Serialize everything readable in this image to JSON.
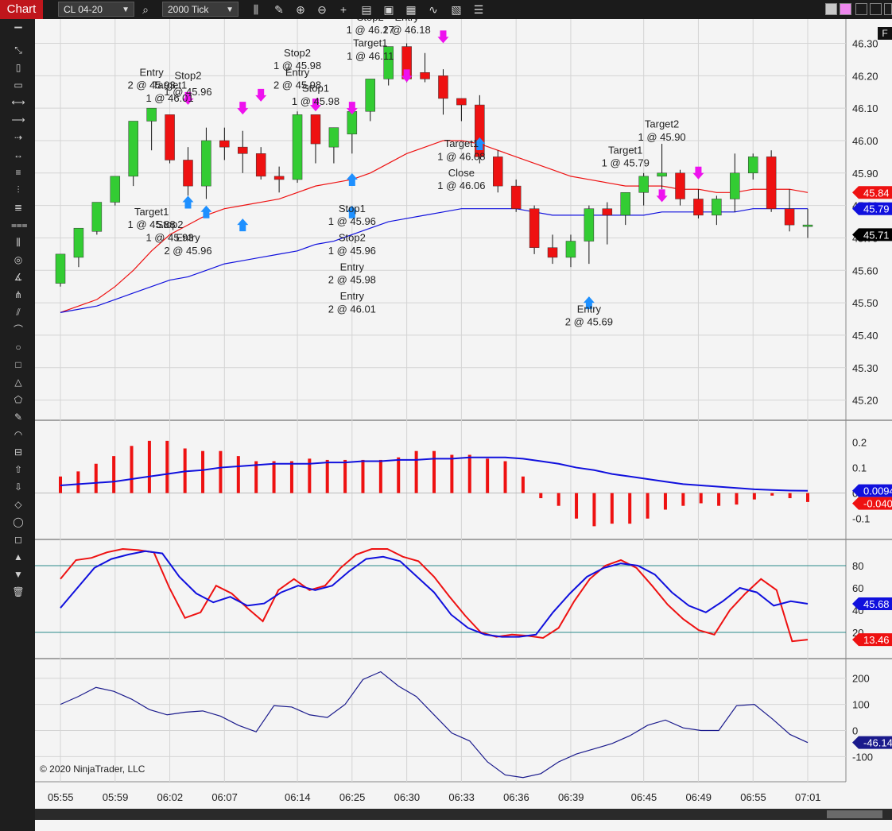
{
  "toolbar": {
    "tab_label": "Chart",
    "instrument": "CL 04-20",
    "interval": "2000 Tick",
    "icons": [
      "search-icon",
      "bar-type-icon",
      "pencil-icon",
      "zoom-in-icon",
      "zoom-out-icon",
      "crosshair-icon",
      "data-box-icon",
      "properties-icon",
      "strategies-icon",
      "indicators-icon",
      "templates-icon",
      "list-icon"
    ]
  },
  "side_toolbar_icons": [
    "ruler-icon",
    "risk-reward-icon",
    "region-icon",
    "range-icon",
    "line-icon",
    "ray-icon",
    "arrow-line-icon",
    "extended-line-icon",
    "horizontal-line-icon",
    "vertical-line-icon",
    "fib-retracement-icon",
    "fib-extension-icon",
    "fib-time-icon",
    "fib-circle-icon",
    "gann-fan-icon",
    "andrews-pitchfork-icon",
    "regression-channel-icon",
    "arc-icon",
    "ellipse-icon",
    "rectangle-icon",
    "triangle-icon",
    "polygon-icon",
    "text-icon",
    "arc2-icon",
    "ruler2-icon",
    "arrow-up-icon",
    "arrow-down-icon",
    "diamond-icon",
    "dot-icon",
    "square-icon",
    "triangle-up-icon",
    "triangle-down-icon",
    "trash-icon"
  ],
  "copyright": "© 2020 NinjaTrader, LLC",
  "corner_label": "F",
  "colors": {
    "up": "#33cc33",
    "down": "#ee1111",
    "blue": "#1010dd",
    "red": "#ee1111",
    "teal": "#2a8a8a",
    "navy": "#1a1a8c",
    "magenta": "#ee11ee",
    "entry_blue": "#1e90ff"
  },
  "chart_data": [
    {
      "type": "candlestick",
      "panel": "price",
      "x_labels": [
        "05:55",
        "05:59",
        "06:02",
        "06:07",
        "06:14",
        "06:25",
        "06:30",
        "06:33",
        "06:36",
        "06:39",
        "06:45",
        "06:49",
        "06:55",
        "07:01"
      ],
      "y_ticks": [
        46.3,
        46.2,
        46.1,
        46.0,
        45.9,
        45.8,
        45.7,
        45.6,
        45.5,
        45.4,
        45.3,
        45.2
      ],
      "ylim": [
        45.15,
        46.36
      ],
      "candles": [
        [
          45.56,
          45.65,
          45.55,
          45.65
        ],
        [
          45.64,
          45.73,
          45.61,
          45.73
        ],
        [
          45.72,
          45.81,
          45.71,
          45.81
        ],
        [
          45.81,
          45.89,
          45.8,
          45.89
        ],
        [
          45.89,
          46.06,
          45.86,
          46.06
        ],
        [
          46.06,
          46.1,
          45.97,
          46.08
        ],
        [
          46.08,
          45.94,
          45.93,
          46.08
        ],
        [
          45.94,
          45.86,
          45.83,
          45.98
        ],
        [
          45.86,
          46.0,
          45.82,
          46.04
        ],
        [
          46.0,
          45.98,
          45.94,
          46.04
        ],
        [
          45.98,
          45.96,
          45.9,
          46.03
        ],
        [
          45.96,
          45.89,
          45.88,
          45.98
        ],
        [
          45.89,
          45.88,
          45.84,
          45.92
        ],
        [
          45.88,
          46.08,
          45.87,
          46.09
        ],
        [
          46.08,
          45.99,
          45.93,
          46.08
        ],
        [
          45.98,
          46.04,
          45.93,
          46.04
        ],
        [
          46.02,
          46.09,
          45.96,
          46.09
        ],
        [
          46.09,
          46.19,
          46.06,
          46.19
        ],
        [
          46.19,
          46.29,
          46.17,
          46.29
        ],
        [
          46.29,
          46.19,
          46.18,
          46.3
        ],
        [
          46.21,
          46.19,
          46.18,
          46.27
        ],
        [
          46.2,
          46.13,
          46.08,
          46.22
        ],
        [
          46.13,
          46.11,
          46.06,
          46.13
        ],
        [
          46.11,
          45.95,
          45.93,
          46.14
        ],
        [
          45.95,
          45.86,
          45.84,
          45.97
        ],
        [
          45.86,
          45.79,
          45.78,
          45.88
        ],
        [
          45.79,
          45.67,
          45.65,
          45.8
        ],
        [
          45.67,
          45.64,
          45.62,
          45.71
        ],
        [
          45.64,
          45.69,
          45.61,
          45.71
        ],
        [
          45.69,
          45.79,
          45.62,
          45.8
        ],
        [
          45.79,
          45.77,
          45.68,
          45.81
        ],
        [
          45.77,
          45.84,
          45.74,
          45.84
        ],
        [
          45.84,
          45.89,
          45.8,
          45.9
        ],
        [
          45.89,
          45.9,
          45.85,
          45.99
        ],
        [
          45.9,
          45.82,
          45.8,
          45.91
        ],
        [
          45.82,
          45.77,
          45.76,
          45.85
        ],
        [
          45.77,
          45.82,
          45.74,
          45.83
        ],
        [
          45.82,
          45.9,
          45.78,
          45.96
        ],
        [
          45.9,
          45.95,
          45.88,
          45.96
        ],
        [
          45.95,
          45.79,
          45.78,
          45.97
        ],
        [
          45.79,
          45.74,
          45.72,
          45.85
        ],
        [
          45.74,
          45.74,
          45.7,
          45.79
        ]
      ],
      "series": [
        {
          "color": "red",
          "values": [
            45.47,
            45.49,
            45.51,
            45.55,
            45.6,
            45.66,
            45.71,
            45.74,
            45.77,
            45.79,
            45.8,
            45.81,
            45.82,
            45.84,
            45.86,
            45.87,
            45.88,
            45.9,
            45.93,
            45.96,
            45.98,
            46.0,
            46.0,
            45.99,
            45.97,
            45.95,
            45.93,
            45.91,
            45.89,
            45.88,
            45.87,
            45.86,
            45.86,
            45.86,
            45.85,
            45.85,
            45.84,
            45.84,
            45.85,
            45.85,
            45.85,
            45.84
          ]
        },
        {
          "color": "blue",
          "values": [
            45.47,
            45.48,
            45.49,
            45.51,
            45.53,
            45.55,
            45.57,
            45.58,
            45.6,
            45.62,
            45.63,
            45.64,
            45.65,
            45.66,
            45.68,
            45.69,
            45.71,
            45.73,
            45.75,
            45.76,
            45.77,
            45.78,
            45.79,
            45.79,
            45.79,
            45.79,
            45.78,
            45.77,
            45.77,
            45.77,
            45.77,
            45.77,
            45.77,
            45.78,
            45.78,
            45.78,
            45.78,
            45.78,
            45.79,
            45.79,
            45.79,
            45.79
          ]
        }
      ],
      "annotations": [
        {
          "text": "Entry",
          "x": 5,
          "y": 46.2
        },
        {
          "text": "2 @ 45.93",
          "x": 5,
          "y": 46.16
        },
        {
          "text": "Target1",
          "x": 6,
          "y": 46.16
        },
        {
          "text": "1 @ 46.01",
          "x": 6,
          "y": 46.12
        },
        {
          "text": "Stop2",
          "x": 7,
          "y": 46.19
        },
        {
          "text": "1 @ 45.96",
          "x": 7,
          "y": 46.14
        },
        {
          "text": "Target1",
          "x": 5,
          "y": 45.77
        },
        {
          "text": "1 @ 45.88",
          "x": 5,
          "y": 45.73
        },
        {
          "text": "Stop2",
          "x": 6,
          "y": 45.73
        },
        {
          "text": "1 @ 45.93",
          "x": 6,
          "y": 45.69
        },
        {
          "text": "Entry",
          "x": 7,
          "y": 45.69
        },
        {
          "text": "2 @ 45.96",
          "x": 7,
          "y": 45.65
        },
        {
          "text": "Stop2",
          "x": 13,
          "y": 46.26
        },
        {
          "text": "1 @ 45.98",
          "x": 13,
          "y": 46.22
        },
        {
          "text": "Entry",
          "x": 13,
          "y": 46.2
        },
        {
          "text": "2 @ 45.98",
          "x": 13,
          "y": 46.16
        },
        {
          "text": "Stop1",
          "x": 14,
          "y": 46.15
        },
        {
          "text": "1 @ 45.98",
          "x": 14,
          "y": 46.11
        },
        {
          "text": "Target1",
          "x": 17,
          "y": 46.29
        },
        {
          "text": "1 @ 46.11",
          "x": 17,
          "y": 46.25
        },
        {
          "text": "Stop2",
          "x": 17,
          "y": 46.37
        },
        {
          "text": "1 @ 46.17",
          "x": 17,
          "y": 46.33
        },
        {
          "text": "Entry",
          "x": 19,
          "y": 46.37
        },
        {
          "text": "2 @ 46.18",
          "x": 19,
          "y": 46.33
        },
        {
          "text": "Stop1",
          "x": 16,
          "y": 45.78
        },
        {
          "text": "1 @ 45.96",
          "x": 16,
          "y": 45.74
        },
        {
          "text": "Stop2",
          "x": 16,
          "y": 45.69
        },
        {
          "text": "1 @ 45.96",
          "x": 16,
          "y": 45.65
        },
        {
          "text": "Entry",
          "x": 16,
          "y": 45.6
        },
        {
          "text": "2 @ 45.98",
          "x": 16,
          "y": 45.56
        },
        {
          "text": "Entry",
          "x": 16,
          "y": 45.51
        },
        {
          "text": "2 @ 46.01",
          "x": 16,
          "y": 45.47
        },
        {
          "text": "Target1",
          "x": 22,
          "y": 45.98
        },
        {
          "text": "1 @ 46.08",
          "x": 22,
          "y": 45.94
        },
        {
          "text": "Close",
          "x": 22,
          "y": 45.89
        },
        {
          "text": "1 @ 46.06",
          "x": 22,
          "y": 45.85
        },
        {
          "text": "Entry",
          "x": 29,
          "y": 45.47
        },
        {
          "text": "2 @ 45.69",
          "x": 29,
          "y": 45.43
        },
        {
          "text": "Target1",
          "x": 31,
          "y": 45.96
        },
        {
          "text": "1 @ 45.79",
          "x": 31,
          "y": 45.92
        },
        {
          "text": "Target2",
          "x": 33,
          "y": 46.04
        },
        {
          "text": "1 @ 45.90",
          "x": 33,
          "y": 46.0
        }
      ],
      "markers": [
        {
          "kind": "down",
          "x": 7,
          "y": 46.13
        },
        {
          "kind": "down",
          "x": 10,
          "y": 46.1
        },
        {
          "kind": "down",
          "x": 11,
          "y": 46.14
        },
        {
          "kind": "down",
          "x": 14,
          "y": 46.11
        },
        {
          "kind": "down",
          "x": 16,
          "y": 46.1
        },
        {
          "kind": "down",
          "x": 19,
          "y": 46.2
        },
        {
          "kind": "down",
          "x": 21,
          "y": 46.32
        },
        {
          "kind": "down",
          "x": 33,
          "y": 45.83
        },
        {
          "kind": "down",
          "x": 35,
          "y": 45.9
        },
        {
          "kind": "up",
          "x": 7,
          "y": 45.81
        },
        {
          "kind": "up",
          "x": 8,
          "y": 45.78
        },
        {
          "kind": "up",
          "x": 10,
          "y": 45.74
        },
        {
          "kind": "up",
          "x": 16,
          "y": 45.88
        },
        {
          "kind": "up",
          "x": 16,
          "y": 45.78
        },
        {
          "kind": "up",
          "x": 23,
          "y": 45.99
        },
        {
          "kind": "up",
          "x": 29,
          "y": 45.5
        }
      ],
      "price_labels": [
        {
          "text": "45.84",
          "value": 45.84,
          "color": "red"
        },
        {
          "text": "45.79",
          "value": 45.79,
          "color": "blue"
        },
        {
          "text": "45.71",
          "value": 45.71,
          "color": "black"
        }
      ]
    },
    {
      "type": "bar",
      "panel": "macd",
      "y_ticks": [
        0.2,
        0.1,
        0,
        -0.1
      ],
      "ylim": [
        -0.16,
        0.27
      ],
      "values": [
        0.065,
        0.085,
        0.115,
        0.145,
        0.185,
        0.205,
        0.205,
        0.175,
        0.165,
        0.165,
        0.145,
        0.125,
        0.125,
        0.125,
        0.135,
        0.13,
        0.13,
        0.13,
        0.13,
        0.14,
        0.165,
        0.165,
        0.15,
        0.15,
        0.135,
        0.125,
        0.065,
        -0.02,
        -0.05,
        -0.1,
        -0.13,
        -0.12,
        -0.12,
        -0.1,
        -0.065,
        -0.05,
        -0.04,
        -0.05,
        -0.045,
        -0.025,
        -0.01,
        -0.02,
        -0.035
      ],
      "series": [
        {
          "color": "blue",
          "values": [
            0.03,
            0.035,
            0.04,
            0.045,
            0.055,
            0.065,
            0.075,
            0.085,
            0.09,
            0.1,
            0.105,
            0.11,
            0.115,
            0.115,
            0.115,
            0.12,
            0.12,
            0.125,
            0.125,
            0.13,
            0.13,
            0.135,
            0.135,
            0.14,
            0.14,
            0.14,
            0.135,
            0.125,
            0.115,
            0.1,
            0.09,
            0.075,
            0.065,
            0.055,
            0.045,
            0.035,
            0.03,
            0.025,
            0.02,
            0.015,
            0.012,
            0.01,
            0.009
          ]
        }
      ],
      "price_labels": [
        {
          "text": "0.00944",
          "value": 0.00944,
          "color": "blue"
        },
        {
          "text": "-0.0406",
          "value": -0.0406,
          "color": "red"
        }
      ]
    },
    {
      "type": "line",
      "panel": "stochastic",
      "y_ticks": [
        80,
        60,
        40,
        20
      ],
      "ylim": [
        0,
        100
      ],
      "levels": [
        80,
        20
      ],
      "x": [
        1,
        2,
        3,
        4,
        5,
        6,
        7,
        8,
        9,
        10,
        11,
        12,
        13,
        14,
        15,
        16,
        17,
        18,
        19,
        20,
        21,
        22,
        23,
        24,
        25,
        26,
        27,
        28,
        29,
        30,
        31,
        32,
        33,
        34,
        35,
        36,
        37,
        38,
        39,
        40,
        41
      ],
      "series": [
        {
          "color": "red",
          "values": [
            68,
            85,
            87,
            92,
            95,
            94,
            92,
            60,
            33,
            38,
            62,
            55,
            42,
            30,
            58,
            68,
            58,
            62,
            78,
            90,
            95,
            95,
            88,
            84,
            70,
            52,
            35,
            20,
            16,
            18,
            17,
            15,
            24,
            48,
            68,
            80,
            85,
            78,
            62,
            45,
            32,
            22,
            18,
            40,
            55,
            68,
            58,
            12,
            13.46
          ]
        },
        {
          "color": "blue",
          "values": [
            42,
            60,
            78,
            86,
            90,
            93,
            91,
            70,
            55,
            47,
            52,
            44,
            46,
            56,
            62,
            58,
            62,
            75,
            86,
            88,
            84,
            70,
            56,
            36,
            24,
            18,
            16,
            16,
            18,
            38,
            55,
            70,
            78,
            82,
            80,
            72,
            56,
            44,
            38,
            48,
            60,
            56,
            44,
            48,
            45.68
          ]
        }
      ],
      "price_labels": [
        {
          "text": "45.68",
          "value": 45.68,
          "color": "blue"
        },
        {
          "text": "13.46",
          "value": 13.46,
          "color": "red"
        }
      ]
    },
    {
      "type": "line",
      "panel": "cci",
      "y_ticks": [
        200,
        100,
        0,
        -100
      ],
      "ylim": [
        -190,
        260
      ],
      "series": [
        {
          "color": "navy",
          "values": [
            100,
            130,
            165,
            150,
            120,
            80,
            60,
            70,
            75,
            55,
            20,
            -5,
            95,
            90,
            60,
            50,
            100,
            195,
            225,
            170,
            130,
            60,
            -10,
            -40,
            -120,
            -170,
            -180,
            -165,
            -120,
            -90,
            -70,
            -50,
            -20,
            20,
            40,
            10,
            0,
            0,
            95,
            100,
            45,
            -15,
            -46.14
          ]
        }
      ],
      "price_labels": [
        {
          "text": "-46.14",
          "value": -46.14,
          "color": "navy"
        }
      ]
    }
  ]
}
